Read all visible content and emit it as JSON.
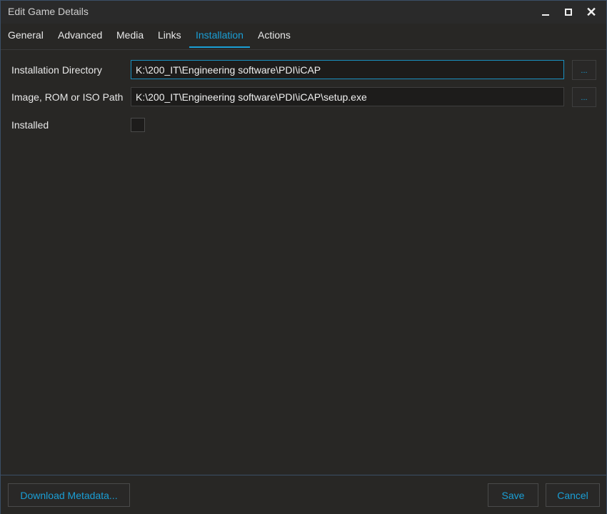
{
  "window": {
    "title": "Edit Game Details"
  },
  "tabs": [
    {
      "label": "General"
    },
    {
      "label": "Advanced"
    },
    {
      "label": "Media"
    },
    {
      "label": "Links"
    },
    {
      "label": "Installation",
      "active": true
    },
    {
      "label": "Actions"
    }
  ],
  "form": {
    "install_dir": {
      "label": "Installation Directory",
      "value": "K:\\200_IT\\Engineering software\\PDI\\iCAP",
      "browse_label": "..."
    },
    "image_path": {
      "label": "Image, ROM or ISO Path",
      "value": "K:\\200_IT\\Engineering software\\PDI\\iCAP\\setup.exe",
      "browse_label": "..."
    },
    "installed": {
      "label": "Installed",
      "checked": false
    }
  },
  "footer": {
    "download_label": "Download Metadata...",
    "save_label": "Save",
    "cancel_label": "Cancel"
  },
  "colors": {
    "accent": "#1a9fd6",
    "background": "#282725",
    "border": "#3b4f66"
  }
}
